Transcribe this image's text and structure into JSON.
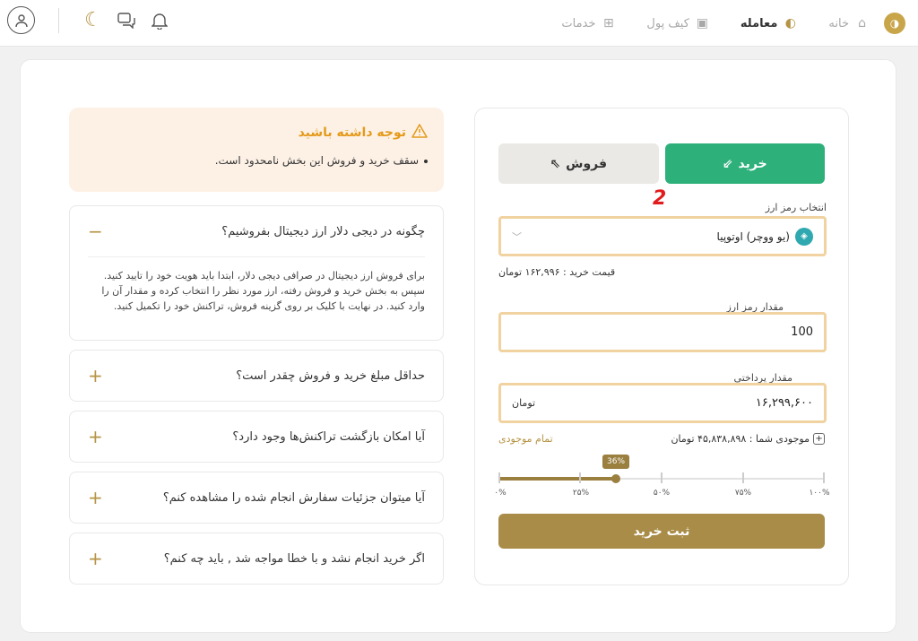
{
  "header": {
    "nav": [
      {
        "label": "خانه",
        "icon": "home-icon",
        "active": false
      },
      {
        "label": "معامله",
        "icon": "trade-icon",
        "active": true
      },
      {
        "label": "کیف پول",
        "icon": "wallet-icon",
        "active": false
      },
      {
        "label": "خدمات",
        "icon": "services-icon",
        "active": false
      }
    ]
  },
  "trade": {
    "buy_label": "خرید",
    "sell_label": "فروش",
    "marker": "2",
    "select_label": "انتخاب رمز ارز",
    "selected_token": "(یو ووچر) اوتوپیا",
    "price_text": "قیمت خرید : ۱۶۲,۹۹۶ تومان",
    "amount_label": "مقدار رمز ارز",
    "amount_value": "100",
    "pay_label": "مقدار پرداختی",
    "pay_value": "۱۶,۲۹۹,۶۰۰",
    "pay_unit": "تومان",
    "balance_text": "موجودی شما : ۴۵,۸۳۸,۸۹۸ تومان",
    "all_balance_label": "تمام موجودی",
    "slider": {
      "value_percent": 36,
      "bubble": "36%",
      "ticks": [
        "۰%",
        "۲۵%",
        "۵۰%",
        "۷۵%",
        "۱۰۰%"
      ]
    },
    "submit_label": "ثبت خرید"
  },
  "notice": {
    "title": "توجه داشته باشید",
    "item": "سقف خرید و فروش این بخش نامحدود است."
  },
  "faq": [
    {
      "q": "چگونه در دیجی دلار ارز دیجیتال بفروشیم؟",
      "open": true,
      "sign": "−",
      "a": "برای فروش ارز دیجیتال در صرافی دیجی دلار، ابتدا باید هویت خود را تایید کنید. سپس به بخش خرید و فروش رفته، ارز مورد نظر را انتخاب کرده و مقدار آن را وارد کنید. در نهایت با کلیک بر روی گزینه فروش، تراکنش خود را تکمیل کنید."
    },
    {
      "q": "حداقل مبلغ خرید و فروش چقدر است؟",
      "open": false,
      "sign": "+"
    },
    {
      "q": "آیا امکان بازگشت تراکنش‌ها وجود دارد؟",
      "open": false,
      "sign": "+"
    },
    {
      "q": "آیا میتوان جزئیات سفارش انجام شده را مشاهده کنم؟",
      "open": false,
      "sign": "+"
    },
    {
      "q": "اگر خرید انجام نشد و با خطا مواجه شد , باید چه کنم؟",
      "open": false,
      "sign": "+"
    }
  ]
}
